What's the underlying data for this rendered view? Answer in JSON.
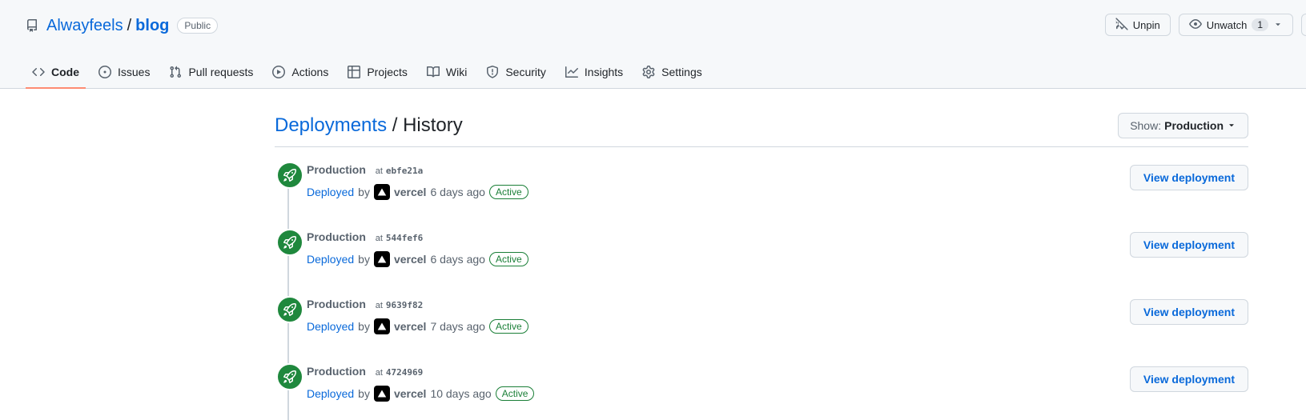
{
  "repo": {
    "owner": "Alwayfeels",
    "separator": "/",
    "name": "blog",
    "visibility": "Public"
  },
  "header_actions": {
    "unpin_label": "Unpin",
    "unwatch_label": "Unwatch",
    "watch_count": "1"
  },
  "tabs": [
    {
      "label": "Code",
      "icon": "code-icon",
      "selected": true
    },
    {
      "label": "Issues",
      "icon": "issue-opened-icon"
    },
    {
      "label": "Pull requests",
      "icon": "git-pull-request-icon"
    },
    {
      "label": "Actions",
      "icon": "play-icon"
    },
    {
      "label": "Projects",
      "icon": "table-icon"
    },
    {
      "label": "Wiki",
      "icon": "book-icon"
    },
    {
      "label": "Security",
      "icon": "shield-icon"
    },
    {
      "label": "Insights",
      "icon": "graph-icon"
    },
    {
      "label": "Settings",
      "icon": "gear-icon"
    }
  ],
  "page": {
    "breadcrumb_link": "Deployments",
    "breadcrumb_sep": "/",
    "title": "History",
    "show_prefix": "Show:",
    "show_value": "Production"
  },
  "deployments": [
    {
      "env": "Production",
      "at": "at",
      "sha": "ebfe21a",
      "deployed": "Deployed",
      "by": "by",
      "user": "vercel",
      "time": "6 days ago",
      "status": "Active",
      "button": "View deployment"
    },
    {
      "env": "Production",
      "at": "at",
      "sha": "544fef6",
      "deployed": "Deployed",
      "by": "by",
      "user": "vercel",
      "time": "6 days ago",
      "status": "Active",
      "button": "View deployment"
    },
    {
      "env": "Production",
      "at": "at",
      "sha": "9639f82",
      "deployed": "Deployed",
      "by": "by",
      "user": "vercel",
      "time": "7 days ago",
      "status": "Active",
      "button": "View deployment"
    },
    {
      "env": "Production",
      "at": "at",
      "sha": "4724969",
      "deployed": "Deployed",
      "by": "by",
      "user": "vercel",
      "time": "10 days ago",
      "status": "Active",
      "button": "View deployment"
    }
  ],
  "colors": {
    "link": "#0969da",
    "success": "#1f883d",
    "tab_underline": "#fd8c73"
  }
}
